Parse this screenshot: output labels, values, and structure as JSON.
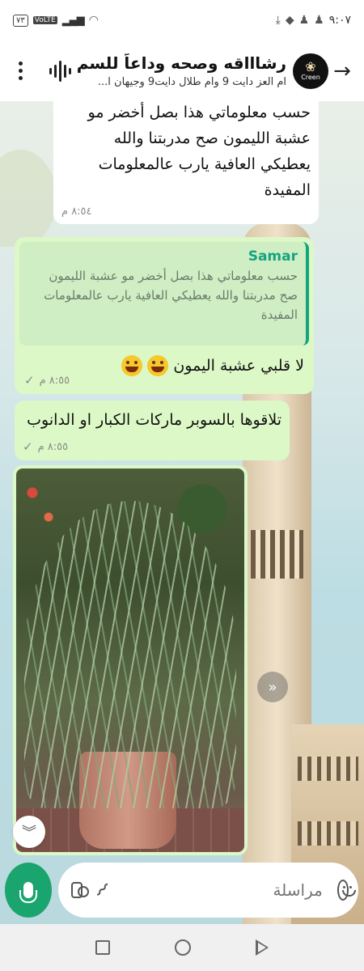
{
  "status_bar": {
    "time": "٩:٠٧",
    "battery": "٧٣",
    "network": "VoLTE"
  },
  "header": {
    "title": "رشاااقه وصحه وداعاً للسم...",
    "members": "ام العز دايت 9 وام طلال دايت9 وجيهان ا...",
    "avatar_label": "Creen"
  },
  "messages": [
    {
      "direction": "in",
      "text": "حسب معلوماتي هذا بصل أخضر مو عشبة الليمون صح مدربتنا والله يعطيكي العافية يارب عالمعلومات المفيدة",
      "time": "٨:٥٤ م"
    },
    {
      "direction": "out",
      "quote_author": "Samar",
      "quote_text": "حسب معلوماتي هذا بصل أخضر مو عشبة الليمون صح مدربتنا والله يعطيكي العافية يارب عالمعلومات المفيدة",
      "text": "لا قلبي عشبة اليمون",
      "time": "٨:٥٥ م"
    },
    {
      "direction": "out",
      "text": "تلاقوها بالسوبر ماركات الكبار او الدانوب",
      "time": "٨:٥٥ م"
    },
    {
      "direction": "out",
      "type": "image",
      "image_subject": "lemongrass-plant-in-pot"
    }
  ],
  "composer": {
    "placeholder": "مراسلة"
  },
  "icons": {
    "back": "arrow-right-icon",
    "voice": "audio-wave-icon",
    "menu": "more-vert-icon",
    "camera": "camera-icon",
    "attach": "paperclip-icon",
    "emoji": "emoji-icon",
    "mic": "mic-icon",
    "forward": "forward-icon",
    "scroll_down": "double-chevron-down-icon"
  },
  "colors": {
    "accent": "#1aa56e",
    "outgoing_bubble": "#dcf8c6",
    "incoming_bubble": "#ffffff",
    "quote_author": "#16a37f"
  }
}
